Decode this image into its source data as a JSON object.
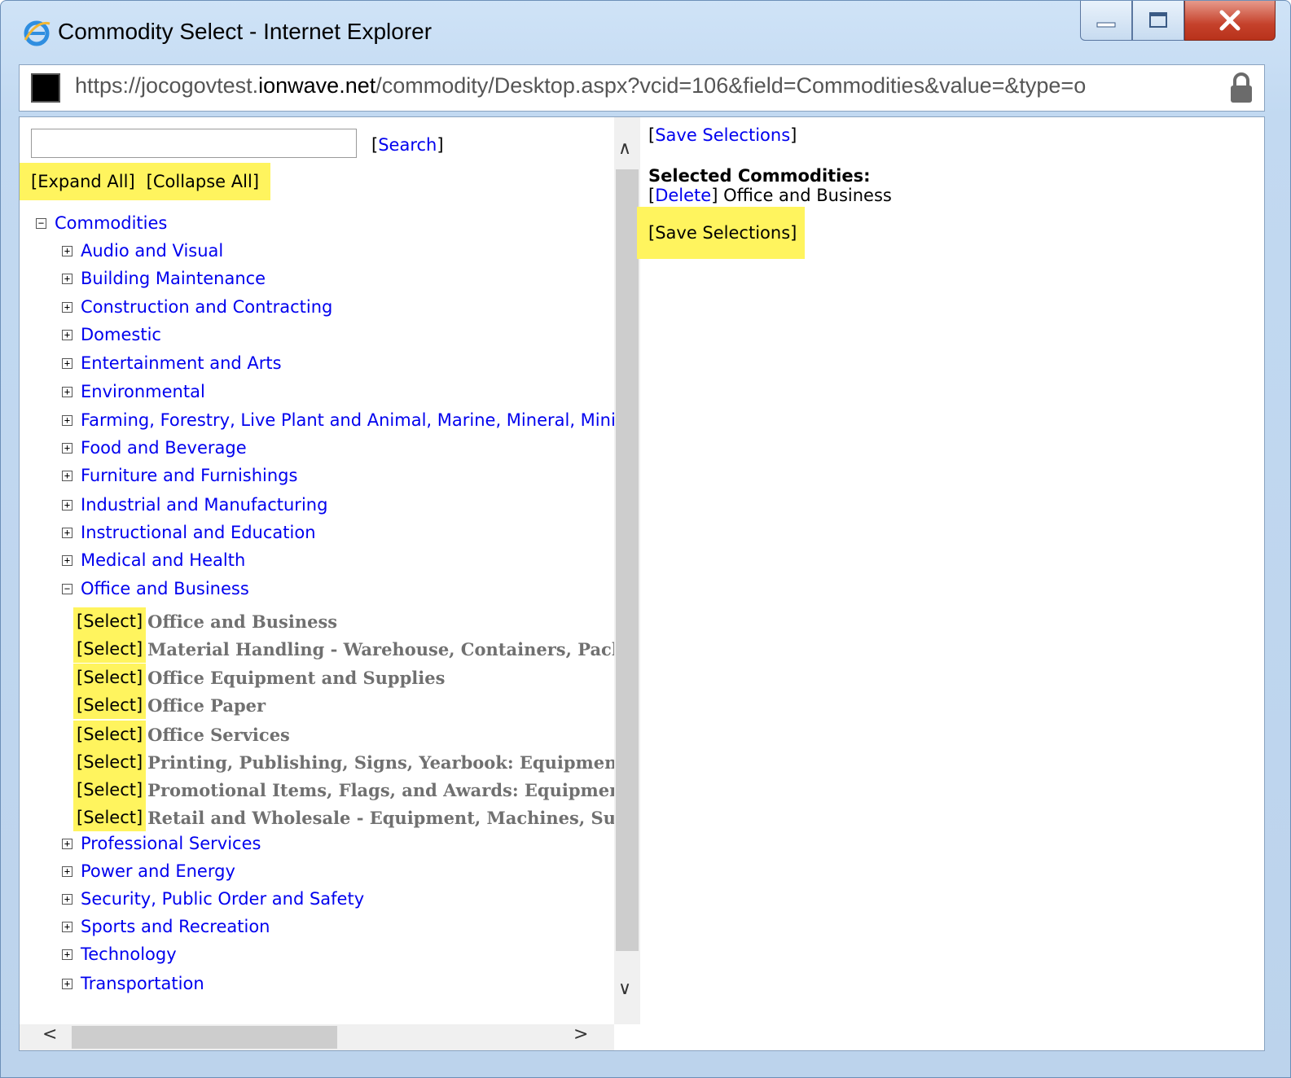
{
  "window": {
    "title": "Commodity Select - Internet Explorer",
    "url_scheme": "https://",
    "url_sub": "jocogovtest.",
    "url_host": "ionwave.net",
    "url_path": "/commodity/Desktop.aspx?vcid=106&field=Commodities&value=&type=o"
  },
  "left": {
    "search_link": "Search",
    "expand_all": "Expand All",
    "collapse_all": "Collapse All",
    "root_label": "Commodities",
    "categories": [
      "Audio and Visual",
      "Building Maintenance",
      "Construction and Contracting",
      "Domestic",
      "Entertainment and Arts",
      "Environmental",
      "Farming, Forestry, Live Plant and Animal, Marine, Mineral, Minin",
      "Food and Beverage",
      "Furniture and Furnishings",
      "Industrial and Manufacturing",
      "Instructional and Education",
      "Medical and Health",
      "Office and Business",
      "Professional Services",
      "Power and Energy",
      "Security, Public Order and Safety",
      "Sports and Recreation",
      "Technology",
      "Transportation"
    ],
    "select_label": "[Select]",
    "office_children": [
      "Office and Business",
      "Material Handling - Warehouse, Containers, Packa",
      "Office Equipment and Supplies",
      "Office Paper",
      "Office Services",
      "Printing, Publishing, Signs, Yearbook: Equipment,",
      "Promotional Items, Flags, and Awards: Equipment",
      "Retail and Wholesale - Equipment, Machines, Supp"
    ]
  },
  "right": {
    "save_label": "Save Selections",
    "selected_heading": "Selected Commodities:",
    "delete_label": "Delete",
    "selected_item": "Office and Business"
  },
  "icons": {
    "expand": "plus-box-icon",
    "collapse": "minus-box-icon"
  },
  "colors": {
    "link": "#0000ee",
    "highlight": "#fff45e",
    "leaf_text": "#707070"
  }
}
